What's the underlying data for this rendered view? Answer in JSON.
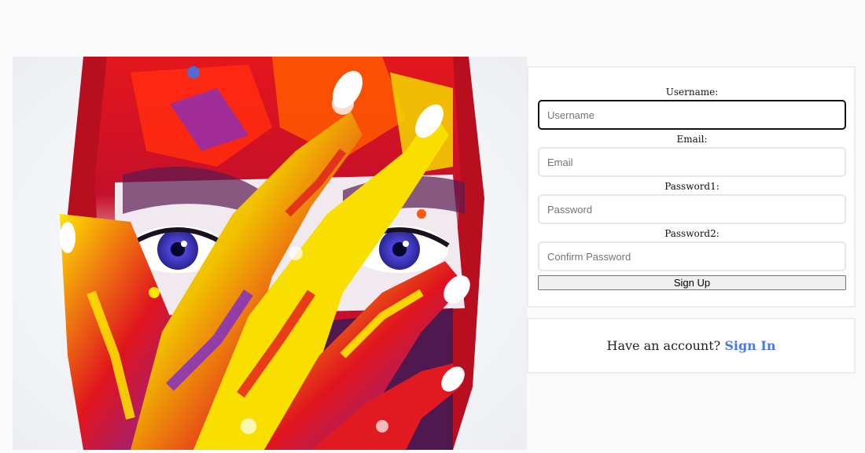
{
  "hero": {
    "image_subject": "face-painted-with-colorful-paint-and-hand-covering-face"
  },
  "signup_form": {
    "username_label": "Username:",
    "username_placeholder": "Username",
    "email_label": "Email:",
    "email_placeholder": "Email",
    "password1_label": "Password1:",
    "password1_placeholder": "Password",
    "password2_label": "Password2:",
    "password2_placeholder": "Confirm Password",
    "submit_label": "Sign Up"
  },
  "signin_box": {
    "prompt": "Have an account?",
    "link_label": "Sign In"
  },
  "colors": {
    "page_background": "#fafafa",
    "card_border": "#ececec",
    "link": "#4a78e8",
    "focused_border": "#111111"
  }
}
